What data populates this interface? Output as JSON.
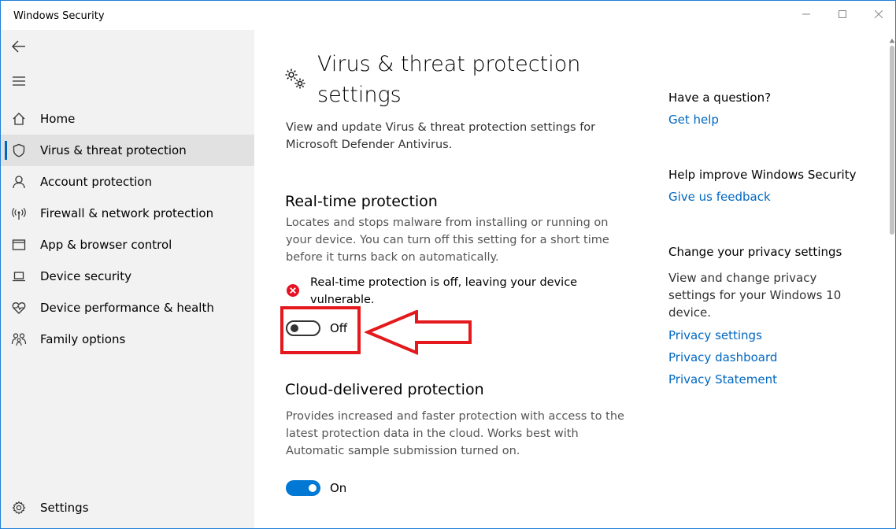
{
  "window": {
    "title": "Windows Security"
  },
  "sidebar": {
    "items": [
      {
        "label": "Home",
        "icon": "home-icon"
      },
      {
        "label": "Virus & threat protection",
        "icon": "shield-icon",
        "active": true
      },
      {
        "label": "Account protection",
        "icon": "person-icon"
      },
      {
        "label": "Firewall & network protection",
        "icon": "antenna-icon"
      },
      {
        "label": "App & browser control",
        "icon": "app-window-icon"
      },
      {
        "label": "Device security",
        "icon": "laptop-icon"
      },
      {
        "label": "Device performance & health",
        "icon": "heart-icon"
      },
      {
        "label": "Family options",
        "icon": "family-icon"
      }
    ],
    "settings_label": "Settings"
  },
  "main": {
    "title": "Virus & threat protection settings",
    "description": "View and update Virus & threat protection settings for Microsoft Defender Antivirus.",
    "realtime": {
      "title": "Real-time protection",
      "description": "Locates and stops malware from installing or running on your device. You can turn off this setting for a short time before it turns back on automatically.",
      "warning": "Real-time protection is off, leaving your device vulnerable.",
      "toggle_state": "Off"
    },
    "cloud": {
      "title": "Cloud-delivered protection",
      "description": "Provides increased and faster protection with access to the latest protection data in the cloud. Works best with Automatic sample submission turned on.",
      "toggle_state": "On"
    }
  },
  "aside": {
    "question_heading": "Have a question?",
    "get_help": "Get help",
    "improve_heading": "Help improve Windows Security",
    "feedback": "Give us feedback",
    "privacy_heading": "Change your privacy settings",
    "privacy_text": "View and change privacy settings for your Windows 10 device.",
    "privacy_links": [
      "Privacy settings",
      "Privacy dashboard",
      "Privacy Statement"
    ]
  },
  "colors": {
    "accent": "#0078d4",
    "link": "#0067c0",
    "annotation_red": "#e3191e",
    "error_red": "#e81123"
  }
}
